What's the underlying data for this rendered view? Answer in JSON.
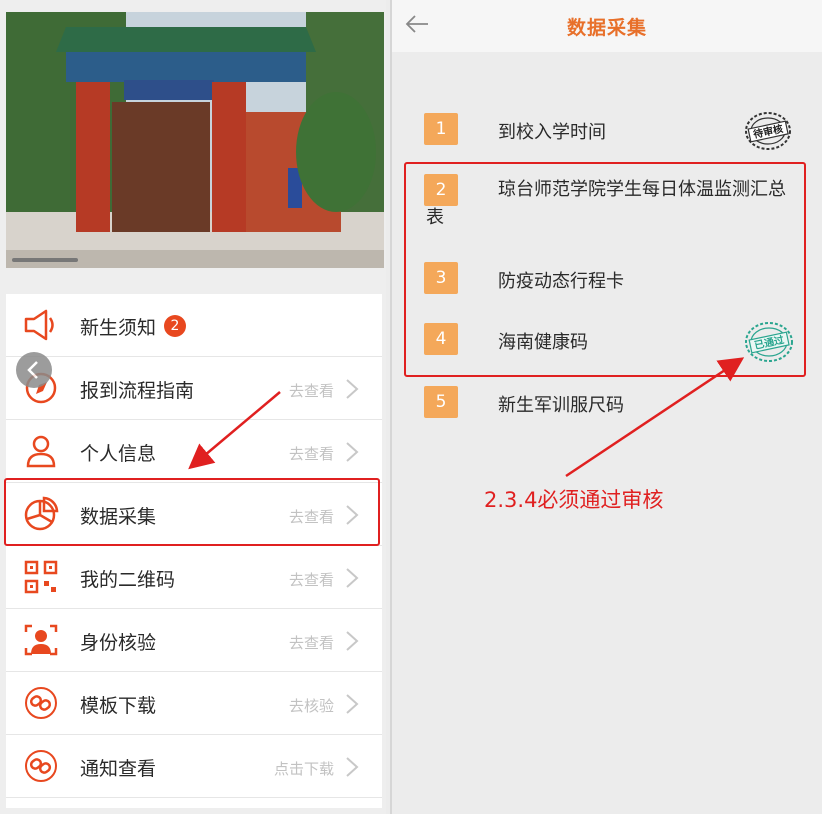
{
  "left": {
    "menu": [
      {
        "icon": "speaker-icon",
        "label": "新生须知",
        "badge": "2",
        "link": ""
      },
      {
        "icon": "compass-icon",
        "label": "报到流程指南",
        "badge": "",
        "link": "去查看"
      },
      {
        "icon": "person-icon",
        "label": "个人信息",
        "badge": "",
        "link": "去查看"
      },
      {
        "icon": "pie-chart-icon",
        "label": "数据采集",
        "badge": "",
        "link": "去查看"
      },
      {
        "icon": "qrcode-icon",
        "label": "我的二维码",
        "badge": "",
        "link": "去查看"
      },
      {
        "icon": "face-scan-icon",
        "label": "身份核验",
        "badge": "",
        "link": "去查看"
      },
      {
        "icon": "template-icon",
        "label": "模板下载",
        "badge": "",
        "link": "去核验"
      },
      {
        "icon": "notice-icon",
        "label": "通知查看",
        "badge": "",
        "link": "点击下载"
      }
    ],
    "highlighted": "数据采集"
  },
  "right": {
    "title": "数据采集",
    "steps": [
      {
        "num": "1",
        "label": "到校入学时间",
        "stamp": "待审核"
      },
      {
        "num": "2",
        "label": "琼台师范学院学生每日体温监测汇总表",
        "stamp": ""
      },
      {
        "num": "3",
        "label": "防疫动态行程卡",
        "stamp": ""
      },
      {
        "num": "4",
        "label": "海南健康码",
        "stamp": "已通过"
      },
      {
        "num": "5",
        "label": "新生军训服尺码",
        "stamp": ""
      }
    ],
    "annotation": "2.3.4必须通过审核"
  },
  "colors": {
    "accent": "#e8702a",
    "step_bg": "#f4a85a",
    "highlight_red": "#e02020",
    "icon_red": "#e8481f",
    "link_gray": "#c2c2c2"
  }
}
